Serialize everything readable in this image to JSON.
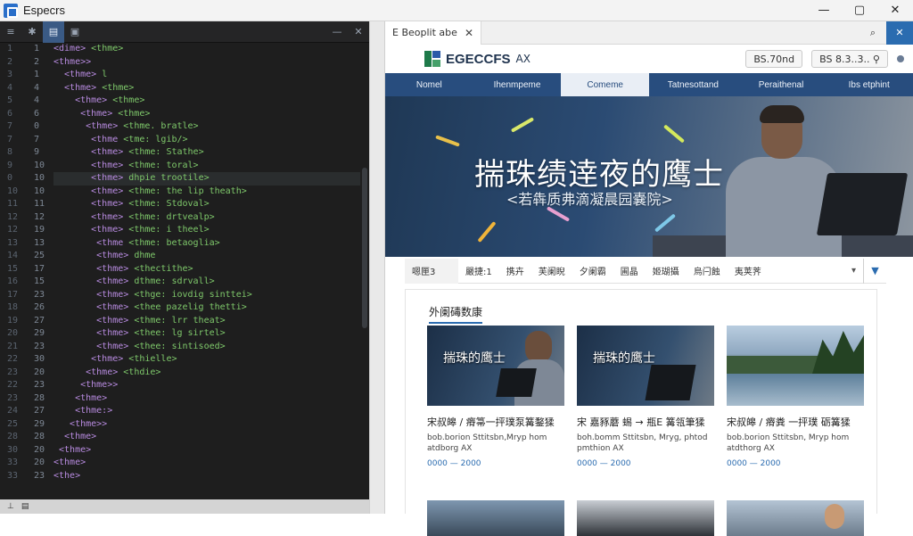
{
  "window": {
    "title": "Especrs",
    "controls": {
      "minimize": "—",
      "maximize": "▢",
      "close": "✕"
    }
  },
  "editor": {
    "toolbar": {
      "b1": "≡",
      "b2": "✱",
      "b3": "▤",
      "b4": "▣",
      "min": "—",
      "close": "✕"
    },
    "gutter": [
      [
        "1",
        "1"
      ],
      [
        "2",
        "2"
      ],
      [
        "3",
        "1"
      ],
      [
        "4",
        "4"
      ],
      [
        "5",
        "4"
      ],
      [
        "6",
        "6"
      ],
      [
        "7",
        "0"
      ],
      [
        "7",
        "7"
      ],
      [
        "8",
        "9"
      ],
      [
        "9",
        "10"
      ],
      [
        "0",
        "10"
      ],
      [
        "10",
        "10"
      ],
      [
        "11",
        "11"
      ],
      [
        "12",
        "12"
      ],
      [
        "12",
        "19"
      ],
      [
        "13",
        "13"
      ],
      [
        "14",
        "25"
      ],
      [
        "15",
        "17"
      ],
      [
        "16",
        "15"
      ],
      [
        "17",
        "23"
      ],
      [
        "18",
        "26"
      ],
      [
        "19",
        "27"
      ],
      [
        "20",
        "29"
      ],
      [
        "21",
        "23"
      ],
      [
        "22",
        "30"
      ],
      [
        "23",
        "20"
      ],
      [
        "22",
        "23"
      ],
      [
        "23",
        "28"
      ],
      [
        "24",
        "27"
      ],
      [
        "25",
        "29"
      ],
      [
        "28",
        "28"
      ],
      [
        "30",
        "20"
      ],
      [
        "33",
        "20"
      ],
      [
        "33",
        "23"
      ]
    ],
    "lines": [
      [
        "<dime> ",
        "<thme>"
      ],
      [
        "<thme>>",
        ""
      ],
      [
        "  <thme> ",
        "l"
      ],
      [
        "  <thme> ",
        "<thme>"
      ],
      [
        "    <thme> ",
        "<thme>"
      ],
      [
        "     <thme> ",
        "<thme>"
      ],
      [
        "      <thme> ",
        "<thme. bratle>"
      ],
      [
        "       <thme ",
        "<tme: lgib/>"
      ],
      [
        "       <thme> ",
        "<thme: Stathe>"
      ],
      [
        "       <thme> ",
        "<thme: toral>"
      ],
      [
        "       <thme> ",
        "dhpie trootile>"
      ],
      [
        "       <thme> ",
        "<thme: the lip theath>"
      ],
      [
        "       <thme> ",
        "<thme: Stdoval>"
      ],
      [
        "       <thme> ",
        "<thme: drtvealp>"
      ],
      [
        "       <thme> ",
        "<thme: i theel>"
      ],
      [
        "        <thme ",
        "<thme: betaoglia>"
      ],
      [
        "        <thme> ",
        "dhme"
      ],
      [
        "        <thme> ",
        "<thectithe>"
      ],
      [
        "        <thme> ",
        "dthme: sdrvall>"
      ],
      [
        "        <thme> ",
        "<thge: iovdig sinttei>"
      ],
      [
        "        <thme> ",
        "<thee pazelig thetti>"
      ],
      [
        "        <thme> ",
        "<thme: lrr theat>"
      ],
      [
        "        <thme> ",
        "<thee: lg sirtel>"
      ],
      [
        "        <thme> ",
        "<thee: sintisoed>"
      ],
      [
        "       <thme> ",
        "<thielle>"
      ],
      [
        "      <thme> ",
        "<thdie>"
      ],
      [
        "     <thme>>",
        ""
      ],
      [
        "    <thme> ",
        ""
      ],
      [
        "    <thme:> ",
        ""
      ],
      [
        "   <thme>>",
        ""
      ],
      [
        "  <thme> ",
        ""
      ],
      [
        " <thme>",
        ""
      ],
      [
        "<thme>",
        ""
      ],
      [
        "<the>",
        ""
      ]
    ],
    "status": {
      "left": "⊥",
      "right": "▤"
    }
  },
  "browser": {
    "tab": {
      "label": "E Beoplit abe",
      "close": "✕"
    },
    "tools": {
      "search": "⌕",
      "close": "✕"
    },
    "site": {
      "logo": "EGECCFS",
      "logo_suffix": "AX",
      "btn1": "BS.70nd",
      "btn2": "BS 8.3..3.. ⚲"
    },
    "nav": [
      "Nomel",
      "Ihenmpeme",
      "Comeme",
      "Tatnesottand",
      "Peraithenal",
      "Ibs etphint"
    ],
    "nav_active": 2,
    "hero": {
      "title": "揣珠绩逹夜的鹰士",
      "subtitle": "<若犇质弗滴凝晨园嚢院>"
    },
    "filters": [
      "嗯匣3",
      "嚴捷:1",
      "携卉",
      "芙阑睨",
      "夕阑霸",
      "圃晶",
      "姬瑚攝",
      "烏闩蝕",
      "夷荚荠"
    ],
    "filter_caret": "▾",
    "filter_drop": "▼",
    "section_title": "外阑碡数康",
    "cards": [
      {
        "img_title": "揣珠的鹰士",
        "title": "宋叔皞 / 瘠箒一抨璞泵篝鍪猱",
        "desc": "bob.borion Sttitsbn,Mryp hom atdborg AX",
        "date": "0000 — 2000"
      },
      {
        "img_title": "揣珠的鹰士",
        "title": "宋 嘉豩蘑 蜴 → 瓶E 篝瓴筆猱",
        "desc": "boh.bomm Sttitsbn, Mryg, phtod pmthion AX",
        "date": "0000 — 2000"
      },
      {
        "img_title": "",
        "title": "宋叔皞 / 瘠粪 一抨璞 砺篝猱",
        "desc": "bob.borion Sttitsbn, Mryp hom atdthorg AX",
        "date": "0000 — 2000"
      }
    ]
  },
  "colors": {
    "nav_bg": "#284d7e",
    "accent": "#2b6cb0",
    "editor_bg": "#1e1e1e",
    "tag": "#b88be0",
    "text_green": "#7fc96b"
  }
}
